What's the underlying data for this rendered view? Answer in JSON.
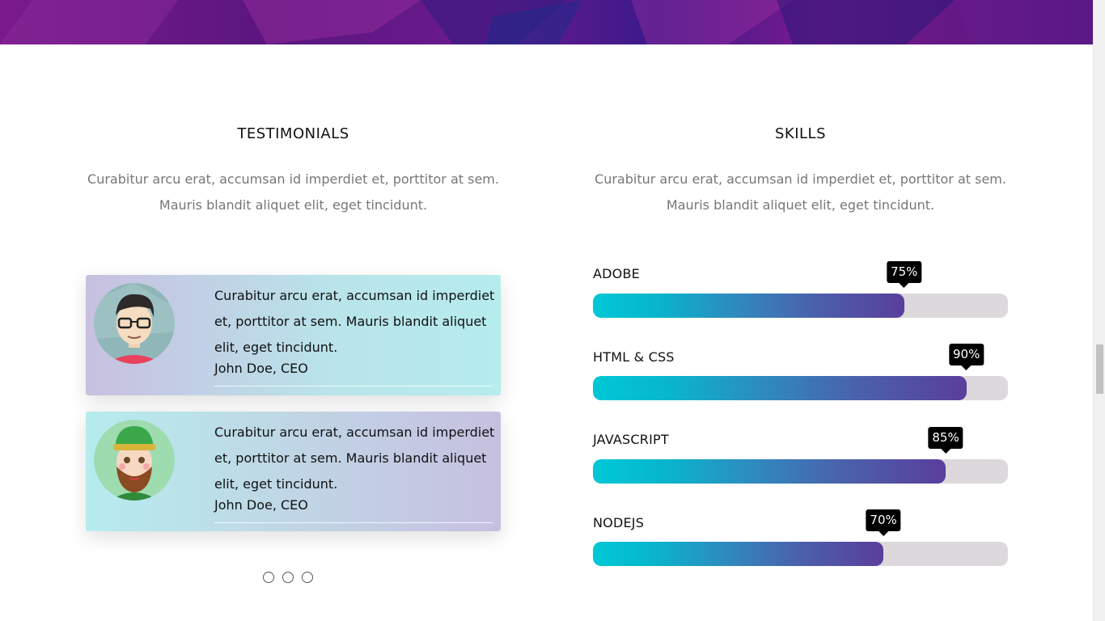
{
  "testimonials": {
    "title": "TESTIMONIALS",
    "desc_line1": "Curabitur arcu erat, accumsan id imperdiet et, porttitor at sem.",
    "desc_line2": "Mauris blandit aliquet elit, eget tincidunt.",
    "cards": [
      {
        "quote": "Curabitur arcu erat, accumsan id imperdiet et, porttitor at sem. Mauris blandit aliquet elit, eget tincidunt.",
        "author": "John Doe, CEO",
        "avatar_icon": "man-with-glasses-avatar-icon"
      },
      {
        "quote": "Curabitur arcu erat, accumsan id imperdiet et, porttitor at sem. Mauris blandit aliquet elit, eget tincidunt.",
        "author": "John Doe, CEO",
        "avatar_icon": "bearded-man-green-hat-avatar-icon"
      }
    ],
    "carousel_dots": 3
  },
  "skills": {
    "title": "SKILLS",
    "desc_line1": "Curabitur arcu erat, accumsan id imperdiet et, porttitor at sem.",
    "desc_line2": "Mauris blandit aliquet elit, eget tincidunt.",
    "items": [
      {
        "label": "ADOBE",
        "value": 75,
        "value_text": "75%"
      },
      {
        "label": "HTML & CSS",
        "value": 90,
        "value_text": "90%"
      },
      {
        "label": "JAVASCRIPT",
        "value": 85,
        "value_text": "85%"
      },
      {
        "label": "NODEJS",
        "value": 70,
        "value_text": "70%"
      }
    ]
  },
  "colors": {
    "bar_start": "#00c8d6",
    "bar_end": "#5a3e9c",
    "track": "#dcd8db",
    "banner": "#5a167f"
  }
}
